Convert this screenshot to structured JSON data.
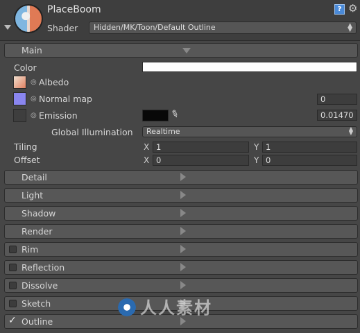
{
  "header": {
    "material_name": "PlaceBoom",
    "shader_label": "Shader",
    "shader_value": "Hidden/MK/Toon/Default Outline",
    "help_label": "?",
    "gear_label": "⚙"
  },
  "main": {
    "title": "Main",
    "color_label": "Color",
    "albedo_label": "Albedo",
    "normal_label": "Normal map",
    "normal_value": "0",
    "emission_label": "Emission",
    "emission_value": "0.01470",
    "gi_label": "Global Illumination",
    "gi_value": "Realtime",
    "tiling_label": "Tiling",
    "offset_label": "Offset",
    "x_label": "X",
    "y_label": "Y",
    "tiling_x": "1",
    "tiling_y": "1",
    "offset_x": "0",
    "offset_y": "0"
  },
  "sections": [
    {
      "label": "Detail"
    },
    {
      "label": "Light"
    },
    {
      "label": "Shadow"
    },
    {
      "label": "Render"
    },
    {
      "label": "Rim"
    },
    {
      "label": "Reflection"
    },
    {
      "label": "Dissolve"
    },
    {
      "label": "Sketch"
    },
    {
      "label": "Outline"
    }
  ],
  "watermark": {
    "text": "人人素材"
  },
  "colors": {
    "panel": "#464646",
    "color_swatch": "#ffffff",
    "emission_swatch": "#080808",
    "normal_slot": "#8a86f0"
  }
}
